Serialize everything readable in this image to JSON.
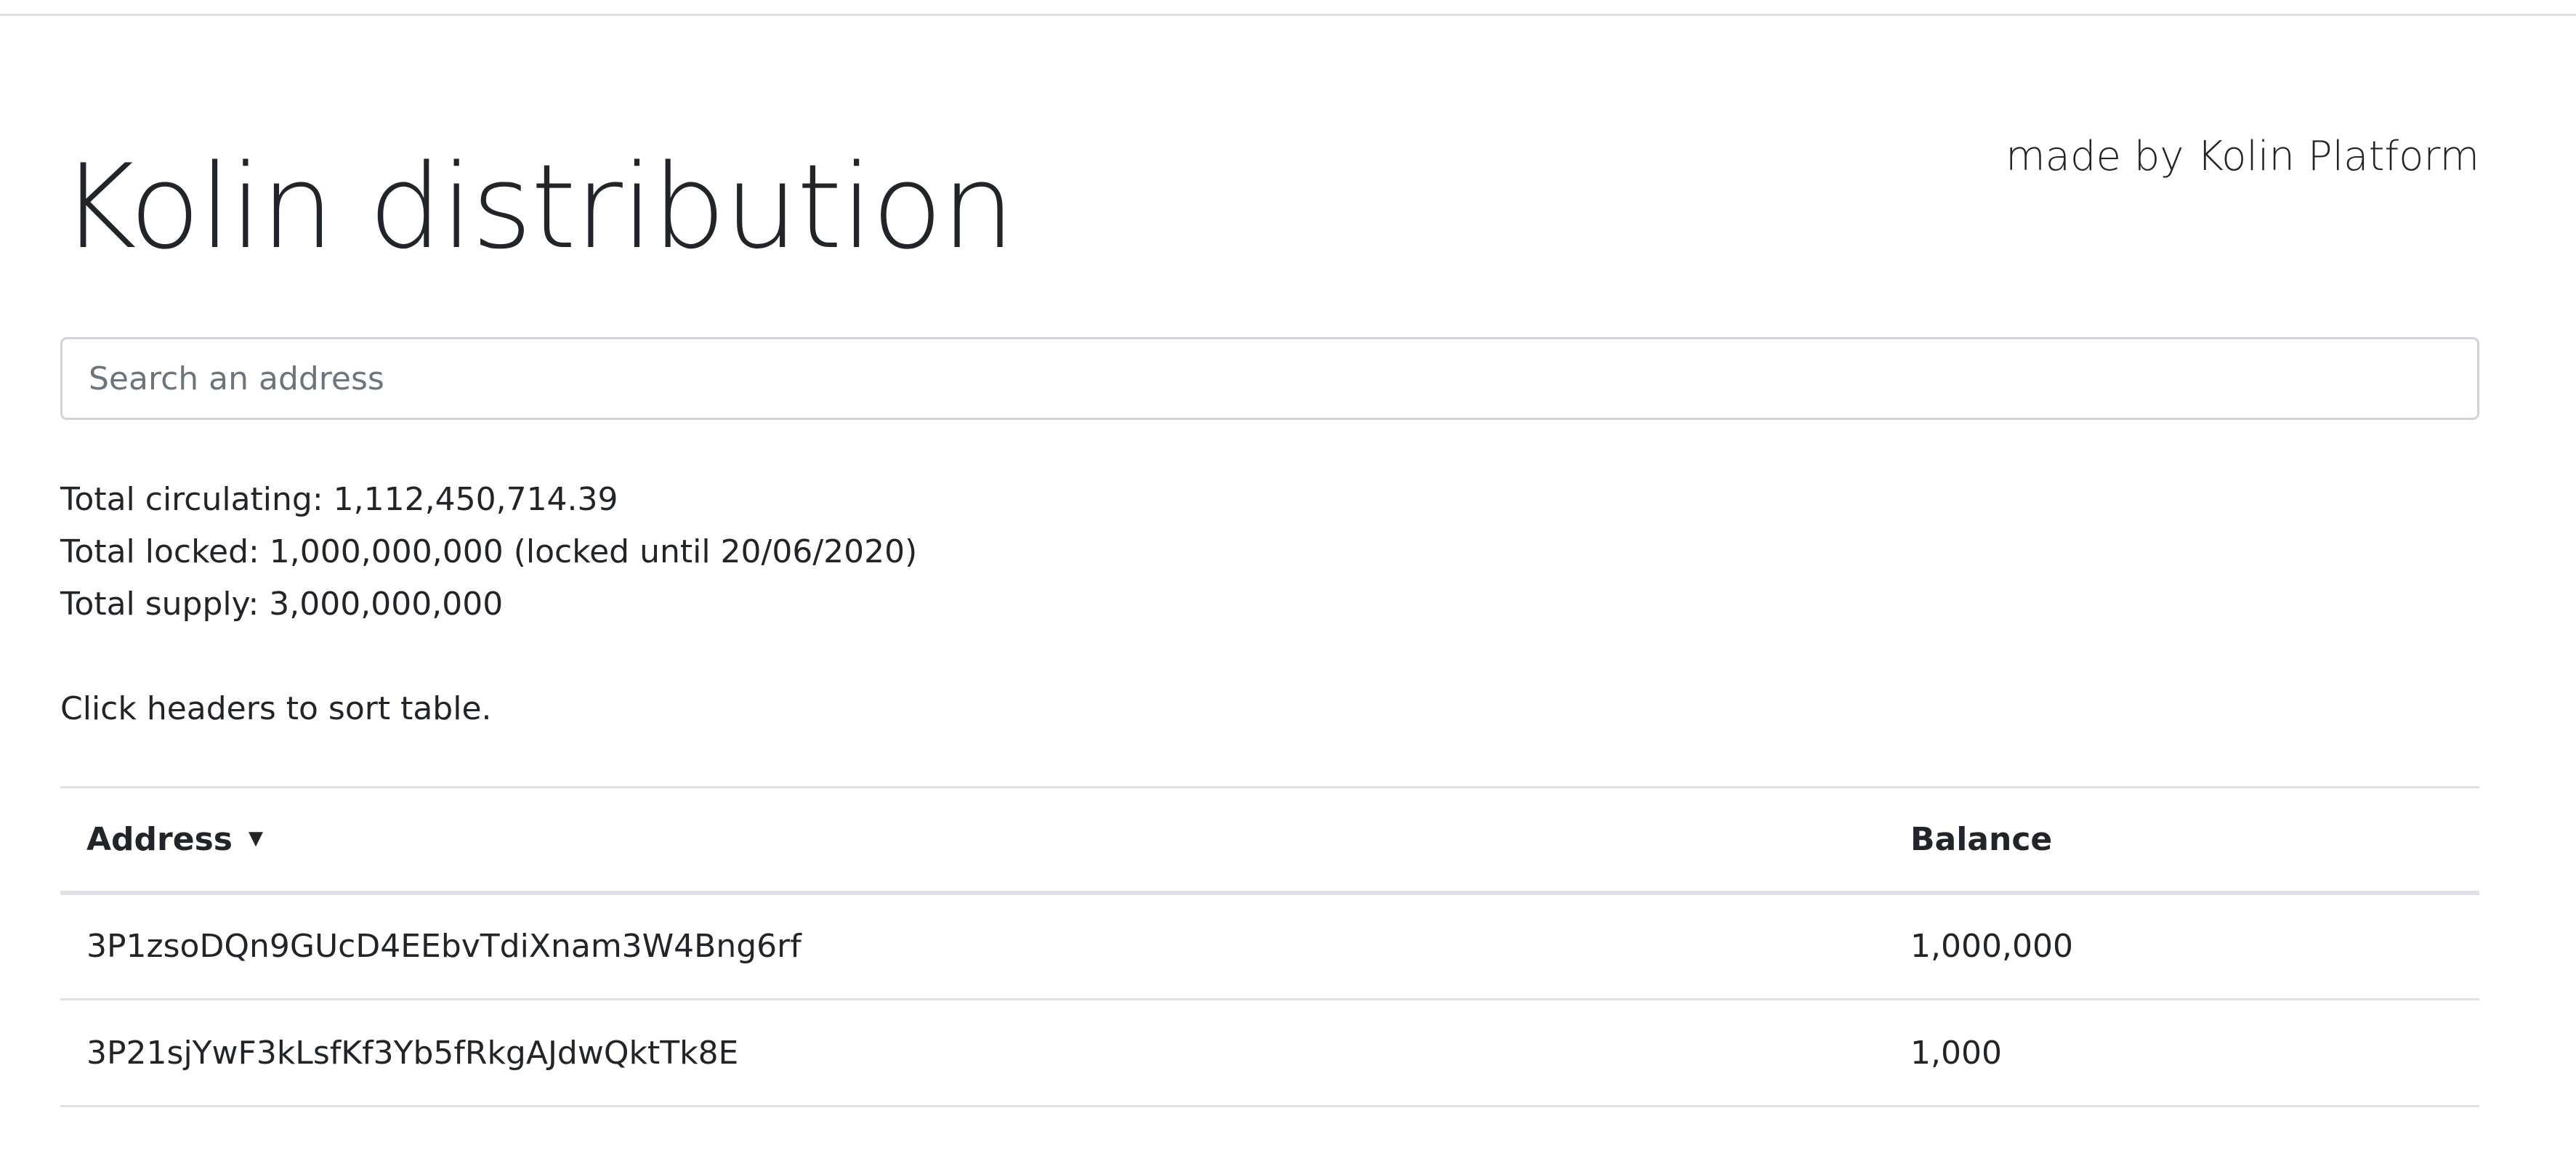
{
  "page": {
    "title": "Kolin distribution",
    "made_by": "made by Kolin Platform"
  },
  "search": {
    "placeholder": "Search an address",
    "value": ""
  },
  "stats": {
    "circulating": "Total circulating: 1,112,450,714.39",
    "locked": "Total locked: 1,000,000,000 (locked until 20/06/2020)",
    "supply": "Total supply: 3,000,000,000"
  },
  "hint": "Click headers to sort table.",
  "table": {
    "columns": [
      {
        "label": "Address",
        "sort_indicator": "▼",
        "icon": "sort-descending-icon"
      },
      {
        "label": "Balance"
      }
    ],
    "rows": [
      {
        "address": "3P1zsoDQn9GUcD4EEbvTdiXnam3W4Bng6rf",
        "balance": "1,000,000"
      },
      {
        "address": "3P21sjYwF3kLsfKf3Yb5fRkgAJdwQktTk8E",
        "balance": "1,000"
      }
    ]
  },
  "colors": {
    "text": "#212529",
    "border": "#dee2e6",
    "input_border": "#ced4da",
    "placeholder": "#6c757d"
  }
}
